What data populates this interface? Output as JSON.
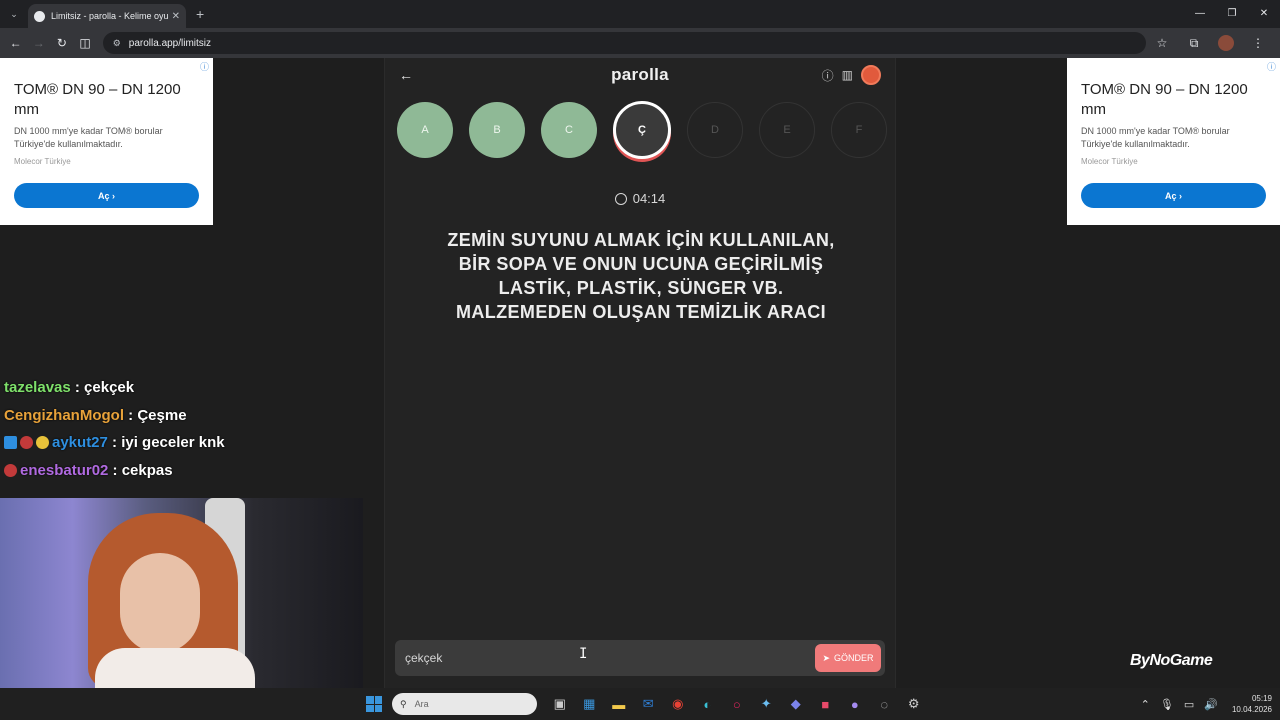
{
  "browser": {
    "tab_title": "Limitsiz - parolla - Kelime oyunu",
    "url": "parolla.app/limitsiz"
  },
  "ads": {
    "headline": "TOM® DN 90 – DN 1200 mm",
    "description": "DN 1000 mm'ye kadar TOM® borular Türkiye'de kullanılmaktadır.",
    "advertiser": "Molecor Türkiye",
    "cta_label": "Aç"
  },
  "game": {
    "logo": "parolla",
    "letters": [
      {
        "label": "A",
        "state": "correct"
      },
      {
        "label": "B",
        "state": "correct"
      },
      {
        "label": "C",
        "state": "correct"
      },
      {
        "label": "Ç",
        "state": "current"
      },
      {
        "label": "D",
        "state": "pending"
      },
      {
        "label": "E",
        "state": "pending"
      },
      {
        "label": "F",
        "state": "pending"
      }
    ],
    "timer": "04:14",
    "question": "ZEMİN SUYUNU ALMAK İÇİN KULLANILAN, BİR SOPA VE ONUN UCUNA GEÇİRİLMİŞ LASTİK, PLASTİK, SÜNGER VB. MALZEMEDEN OLUŞAN TEMİZLİK ARACI",
    "answer_value": "çekçek",
    "send_label": "GÖNDER"
  },
  "chat": [
    {
      "user": "tazelavas",
      "color": "#7ee06a",
      "message": ": çekçek"
    },
    {
      "user": "CengizhanMogol",
      "color": "#e8a23a",
      "message": ": Çeşme"
    },
    {
      "user": "aykut27",
      "color": "#2e8fe0",
      "message": ": iyi geceler knk"
    },
    {
      "user": "enesbatur02",
      "color": "#b06ae0",
      "message": ": cekpas"
    }
  ],
  "watermark": "ByNoGame",
  "taskbar": {
    "search_placeholder": "Ara",
    "time": "05:19",
    "date": "10.04.2026"
  },
  "colors": {
    "correct": "#8fb996",
    "accent": "#f07a7a",
    "background": "#232323"
  }
}
